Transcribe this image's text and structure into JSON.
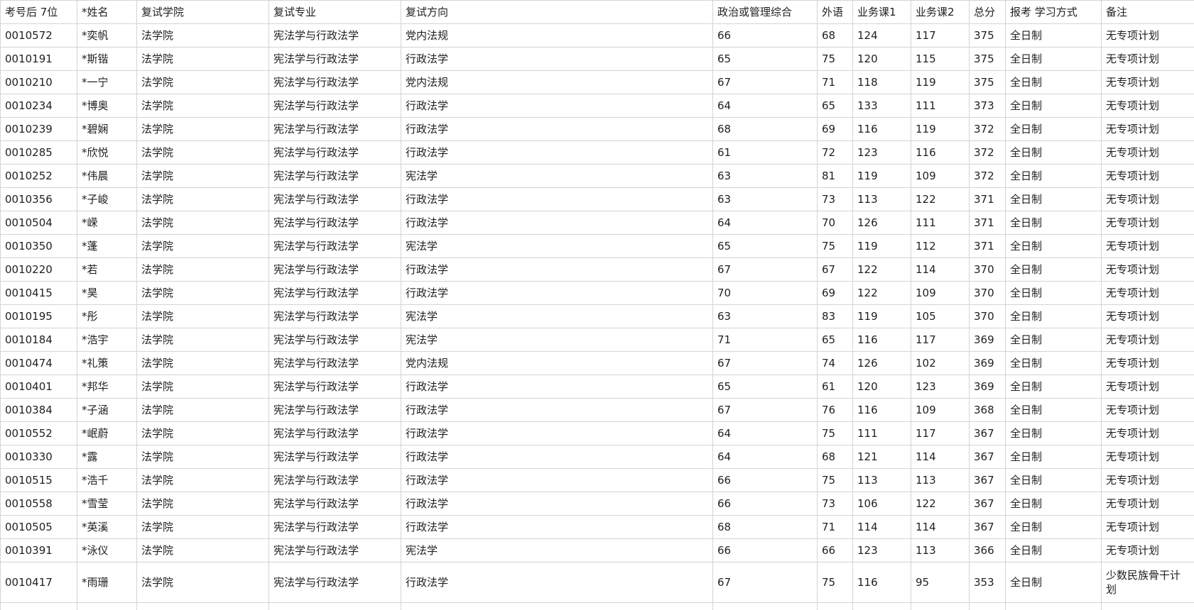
{
  "headers": [
    "考号后 7位",
    "*姓名",
    "复试学院",
    "复试专业",
    "复试方向",
    "政治或管理综合",
    "外语",
    "业务课1",
    "业务课2",
    "总分",
    "报考 学习方式",
    "备注"
  ],
  "rows": [
    [
      "0010572",
      "*奕帆",
      "法学院",
      "宪法学与行政法学",
      "党内法规",
      "66",
      "68",
      "124",
      "117",
      "375",
      "全日制",
      "无专项计划"
    ],
    [
      "0010191",
      "*斯锴",
      "法学院",
      "宪法学与行政法学",
      "行政法学",
      "65",
      "75",
      "120",
      "115",
      "375",
      "全日制",
      "无专项计划"
    ],
    [
      "0010210",
      "*一宁",
      "法学院",
      "宪法学与行政法学",
      "党内法规",
      "67",
      "71",
      "118",
      "119",
      "375",
      "全日制",
      "无专项计划"
    ],
    [
      "0010234",
      "*博奥",
      "法学院",
      "宪法学与行政法学",
      "行政法学",
      "64",
      "65",
      "133",
      "111",
      "373",
      "全日制",
      "无专项计划"
    ],
    [
      "0010239",
      "*碧娴",
      "法学院",
      "宪法学与行政法学",
      "行政法学",
      "68",
      "69",
      "116",
      "119",
      "372",
      "全日制",
      "无专项计划"
    ],
    [
      "0010285",
      "*欣悦",
      "法学院",
      "宪法学与行政法学",
      "行政法学",
      "61",
      "72",
      "123",
      "116",
      "372",
      "全日制",
      "无专项计划"
    ],
    [
      "0010252",
      "*伟晨",
      "法学院",
      "宪法学与行政法学",
      "宪法学",
      "63",
      "81",
      "119",
      "109",
      "372",
      "全日制",
      "无专项计划"
    ],
    [
      "0010356",
      "*子峻",
      "法学院",
      "宪法学与行政法学",
      "行政法学",
      "63",
      "73",
      "113",
      "122",
      "371",
      "全日制",
      "无专项计划"
    ],
    [
      "0010504",
      "*嵘",
      "法学院",
      "宪法学与行政法学",
      "行政法学",
      "64",
      "70",
      "126",
      "111",
      "371",
      "全日制",
      "无专项计划"
    ],
    [
      "0010350",
      "*蓬",
      "法学院",
      "宪法学与行政法学",
      "宪法学",
      "65",
      "75",
      "119",
      "112",
      "371",
      "全日制",
      "无专项计划"
    ],
    [
      "0010220",
      "*若",
      "法学院",
      "宪法学与行政法学",
      "行政法学",
      "67",
      "67",
      "122",
      "114",
      "370",
      "全日制",
      "无专项计划"
    ],
    [
      "0010415",
      "*昊",
      "法学院",
      "宪法学与行政法学",
      "行政法学",
      "70",
      "69",
      "122",
      "109",
      "370",
      "全日制",
      "无专项计划"
    ],
    [
      "0010195",
      "*彤",
      "法学院",
      "宪法学与行政法学",
      "宪法学",
      "63",
      "83",
      "119",
      "105",
      "370",
      "全日制",
      "无专项计划"
    ],
    [
      "0010184",
      "*浩宇",
      "法学院",
      "宪法学与行政法学",
      "宪法学",
      "71",
      "65",
      "116",
      "117",
      "369",
      "全日制",
      "无专项计划"
    ],
    [
      "0010474",
      "*礼策",
      "法学院",
      "宪法学与行政法学",
      "党内法规",
      "67",
      "74",
      "126",
      "102",
      "369",
      "全日制",
      "无专项计划"
    ],
    [
      "0010401",
      "*邦华",
      "法学院",
      "宪法学与行政法学",
      "行政法学",
      "65",
      "61",
      "120",
      "123",
      "369",
      "全日制",
      "无专项计划"
    ],
    [
      "0010384",
      "*子涵",
      "法学院",
      "宪法学与行政法学",
      "行政法学",
      "67",
      "76",
      "116",
      "109",
      "368",
      "全日制",
      "无专项计划"
    ],
    [
      "0010552",
      "*岷蔚",
      "法学院",
      "宪法学与行政法学",
      "行政法学",
      "64",
      "75",
      "111",
      "117",
      "367",
      "全日制",
      "无专项计划"
    ],
    [
      "0010330",
      "*露",
      "法学院",
      "宪法学与行政法学",
      "行政法学",
      "64",
      "68",
      "121",
      "114",
      "367",
      "全日制",
      "无专项计划"
    ],
    [
      "0010515",
      "*浩千",
      "法学院",
      "宪法学与行政法学",
      "行政法学",
      "66",
      "75",
      "113",
      "113",
      "367",
      "全日制",
      "无专项计划"
    ],
    [
      "0010558",
      "*雪莹",
      "法学院",
      "宪法学与行政法学",
      "行政法学",
      "66",
      "73",
      "106",
      "122",
      "367",
      "全日制",
      "无专项计划"
    ],
    [
      "0010505",
      "*英溪",
      "法学院",
      "宪法学与行政法学",
      "行政法学",
      "68",
      "71",
      "114",
      "114",
      "367",
      "全日制",
      "无专项计划"
    ],
    [
      "0010391",
      "*泳仪",
      "法学院",
      "宪法学与行政法学",
      "宪法学",
      "66",
      "66",
      "123",
      "113",
      "366",
      "全日制",
      "无专项计划"
    ],
    [
      "0010417",
      "*雨珊",
      "法学院",
      "宪法学与行政法学",
      "行政法学",
      "67",
      "75",
      "116",
      "95",
      "353",
      "全日制",
      "少数民族骨干计划"
    ]
  ]
}
